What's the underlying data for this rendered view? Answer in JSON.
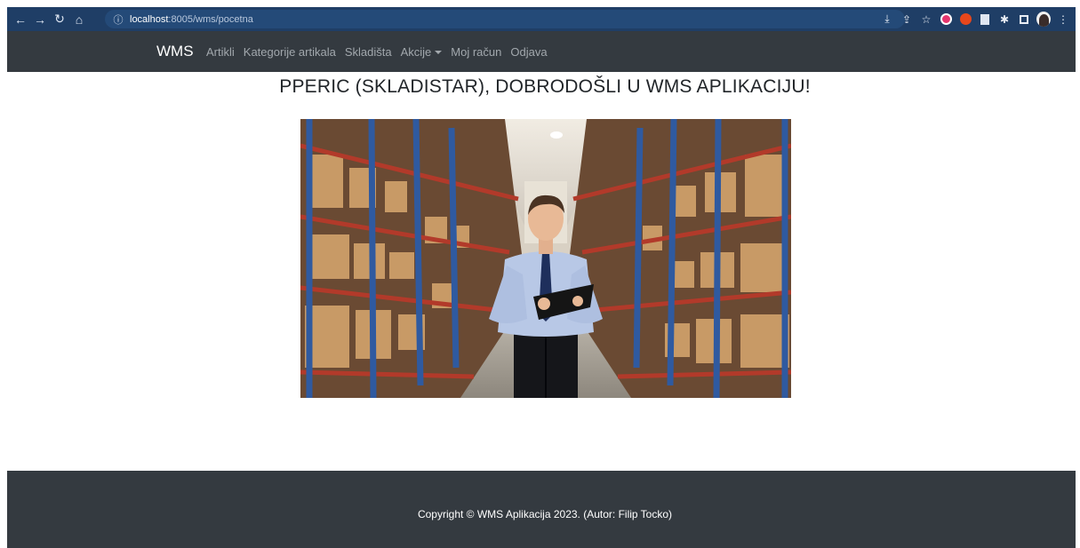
{
  "browser": {
    "url_host": "localhost",
    "url_path": ":8005/wms/pocetna",
    "icons": [
      "back-icon",
      "forward-icon",
      "reload-icon",
      "home-icon",
      "info-icon",
      "install-icon",
      "share-icon",
      "bookmark-star-icon",
      "extension-pink-icon",
      "extension-red-icon",
      "extension-doc-icon",
      "extensions-puzzle-icon",
      "sidebar-icon",
      "profile-avatar-icon",
      "menu-kebab-icon"
    ]
  },
  "navbar": {
    "brand": "WMS",
    "links": [
      "Artikli",
      "Kategorije artikala",
      "Skladišta",
      "Akcije",
      "Moj račun",
      "Odjava"
    ]
  },
  "main": {
    "heading": "PPERIC (SKLADISTAR), DOBRODOŠLI U WMS APLIKACIJU!"
  },
  "footer": {
    "copyright": "Copyright © WMS Aplikacija 2023. (Autor: Filip Tocko)"
  },
  "colors": {
    "browser_bar": "#1f3e66",
    "navbar": "#343a40",
    "footer": "#343a40",
    "nav_link": "#a2a8ad"
  }
}
